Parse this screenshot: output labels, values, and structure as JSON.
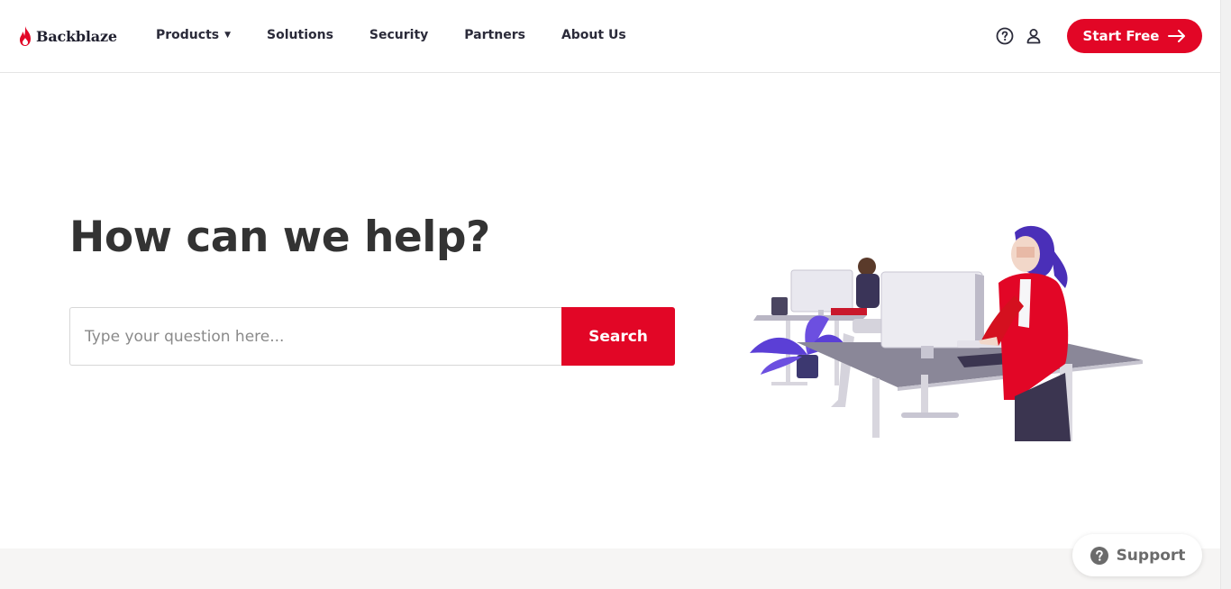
{
  "header": {
    "logo_text": "Backblaze",
    "nav": [
      {
        "label": "Products",
        "has_dropdown": true
      },
      {
        "label": "Solutions"
      },
      {
        "label": "Security"
      },
      {
        "label": "Partners"
      },
      {
        "label": "About Us"
      }
    ],
    "help_icon": "help-circle-icon",
    "account_icon": "user-icon",
    "start_button_label": "Start Free"
  },
  "hero": {
    "title": "How can we help?",
    "search_placeholder": "Type your question here...",
    "search_value": "",
    "search_button_label": "Search"
  },
  "support_widget": {
    "label": "Support"
  },
  "colors": {
    "brand_red": "#e20626",
    "text_dark": "#333333",
    "band_bg": "#f6f5f4"
  }
}
